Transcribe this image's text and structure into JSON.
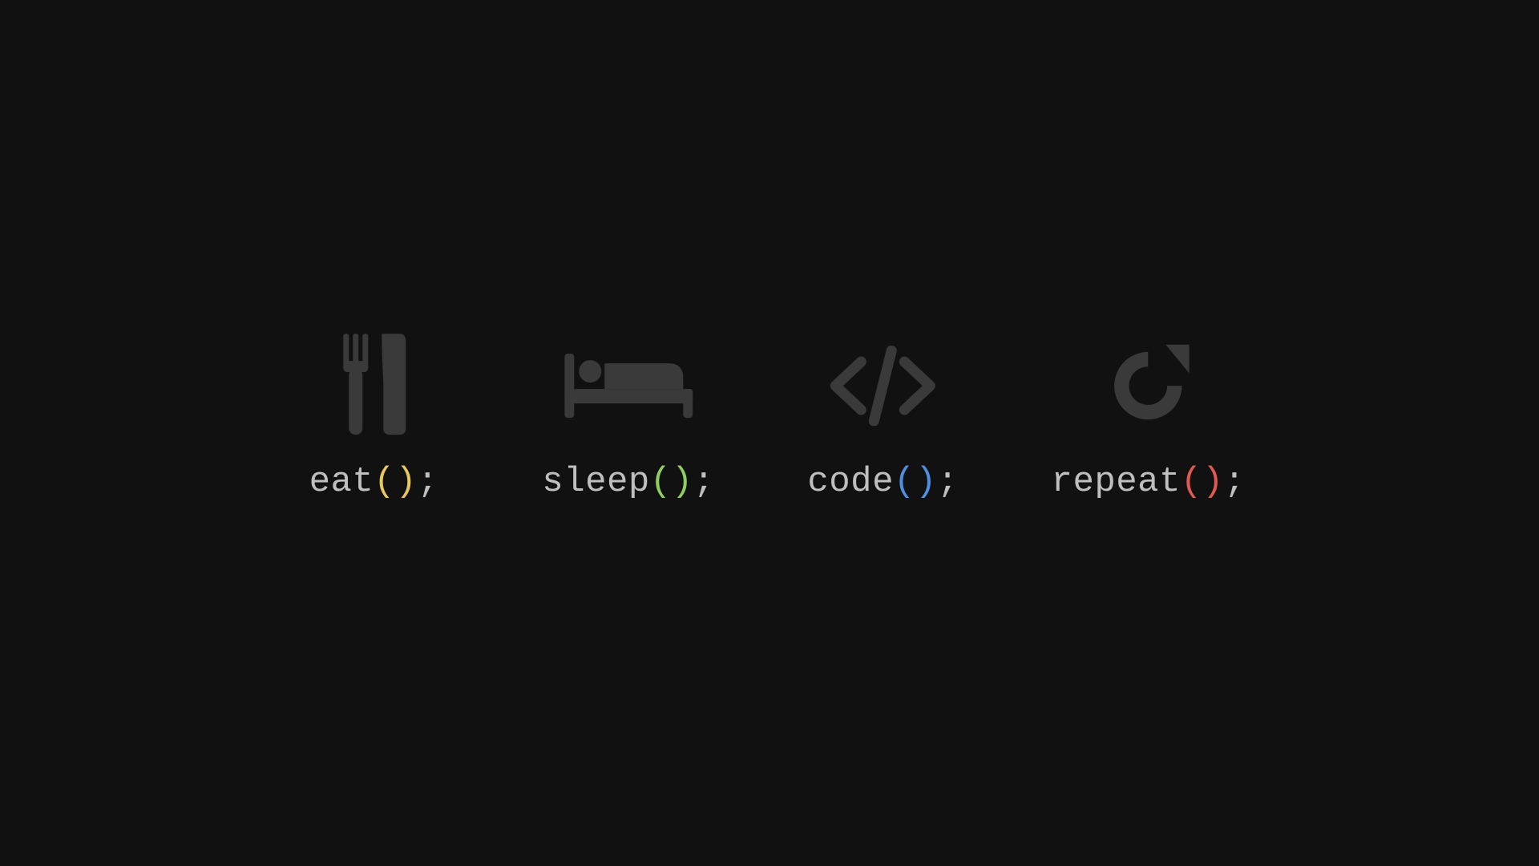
{
  "colors": {
    "background": "#111111",
    "icon": "#3a3a3a",
    "text": "#bfbfbf",
    "parens": [
      "#e8c75d",
      "#8fcf5f",
      "#4f8fe0",
      "#e05a4f"
    ]
  },
  "items": [
    {
      "name": "eat",
      "icon": "fork-knife-icon",
      "paren_color": "#e8c75d"
    },
    {
      "name": "sleep",
      "icon": "bed-icon",
      "paren_color": "#8fcf5f"
    },
    {
      "name": "code",
      "icon": "code-icon",
      "paren_color": "#4f8fe0"
    },
    {
      "name": "repeat",
      "icon": "refresh-icon",
      "paren_color": "#e05a4f"
    }
  ],
  "tokens": {
    "open": "(",
    "close": ")",
    "semi": ";"
  }
}
